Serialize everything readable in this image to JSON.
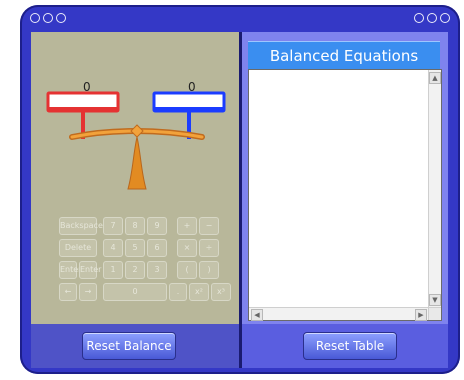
{
  "window": {
    "left_dots": 3,
    "right_dots": 3
  },
  "balance": {
    "left_value": "0",
    "right_value": "0",
    "left_color": "#e53232",
    "right_color": "#1b3cff"
  },
  "keypad": {
    "keys": [
      [
        "Backspace",
        "7",
        "8",
        "9",
        "+",
        "−"
      ],
      [
        "Delete",
        "4",
        "5",
        "6",
        "×",
        "÷"
      ],
      [
        "Enter",
        "Enter",
        "1",
        "2",
        "3",
        "(",
        ")"
      ],
      [
        "←",
        "→",
        "0",
        ".",
        "x²",
        "x³"
      ]
    ]
  },
  "equations_panel": {
    "title": "Balanced Equations"
  },
  "buttons": {
    "reset_balance": "Reset Balance",
    "reset_table": "Reset Table"
  }
}
